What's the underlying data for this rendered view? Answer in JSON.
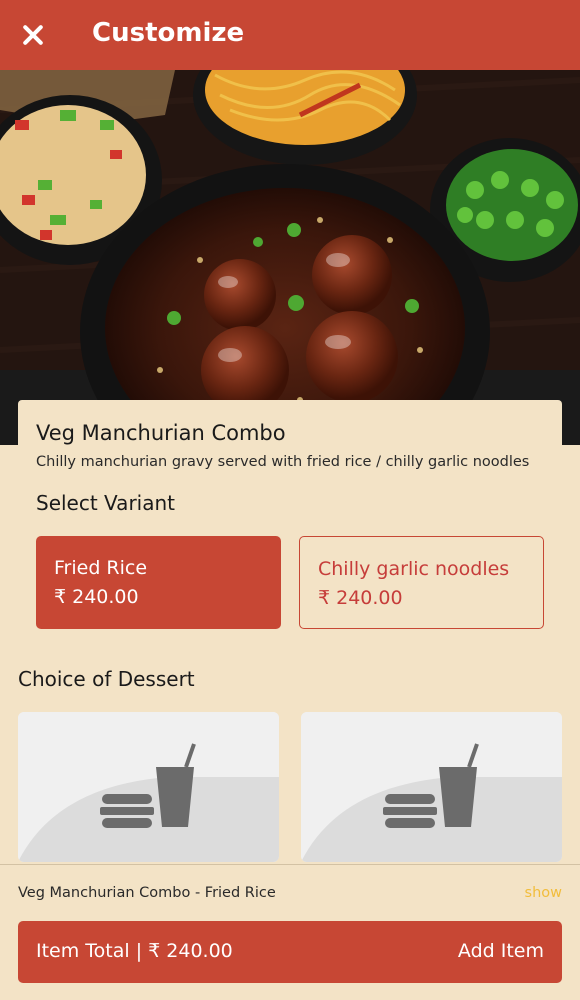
{
  "header": {
    "title": "Customize",
    "close_icon": "close-icon"
  },
  "item": {
    "name": "Veg Manchurian Combo",
    "description": "Chilly manchurian gravy served with fried rice / chilly garlic noodles"
  },
  "variants": {
    "section_title": "Select Variant",
    "options": [
      {
        "name": "Fried Rice",
        "price": "₹ 240.00",
        "selected": true
      },
      {
        "name": "Chilly garlic noodles",
        "price": "₹ 240.00",
        "selected": false
      }
    ]
  },
  "dessert": {
    "section_title": "Choice of Dessert",
    "placeholder_icon": "food-placeholder-icon"
  },
  "footer": {
    "summary": "Veg Manchurian Combo - Fried Rice",
    "show_label": "show",
    "item_total": "Item Total | ₹ 240.00",
    "add_label": "Add Item"
  },
  "colors": {
    "brand": "#c74734",
    "background": "#f3e3c6",
    "link": "#f2bd3b"
  }
}
